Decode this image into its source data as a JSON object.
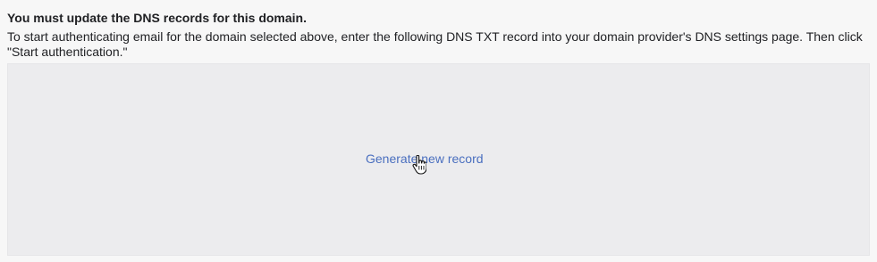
{
  "dns_notice": {
    "heading": "You must update the DNS records for this domain.",
    "description": "To start authenticating email for the domain selected above, enter the following DNS TXT record into your domain provider's DNS settings page. Then click \"Start authentication.\""
  },
  "record_panel": {
    "generate_link_label": "Generate new record"
  },
  "icons": {
    "cursor": "hand-pointer-cursor-icon"
  },
  "colors": {
    "link": "#4a6fbf",
    "panel_background": "#ececee",
    "page_background": "#f7f7f7"
  }
}
